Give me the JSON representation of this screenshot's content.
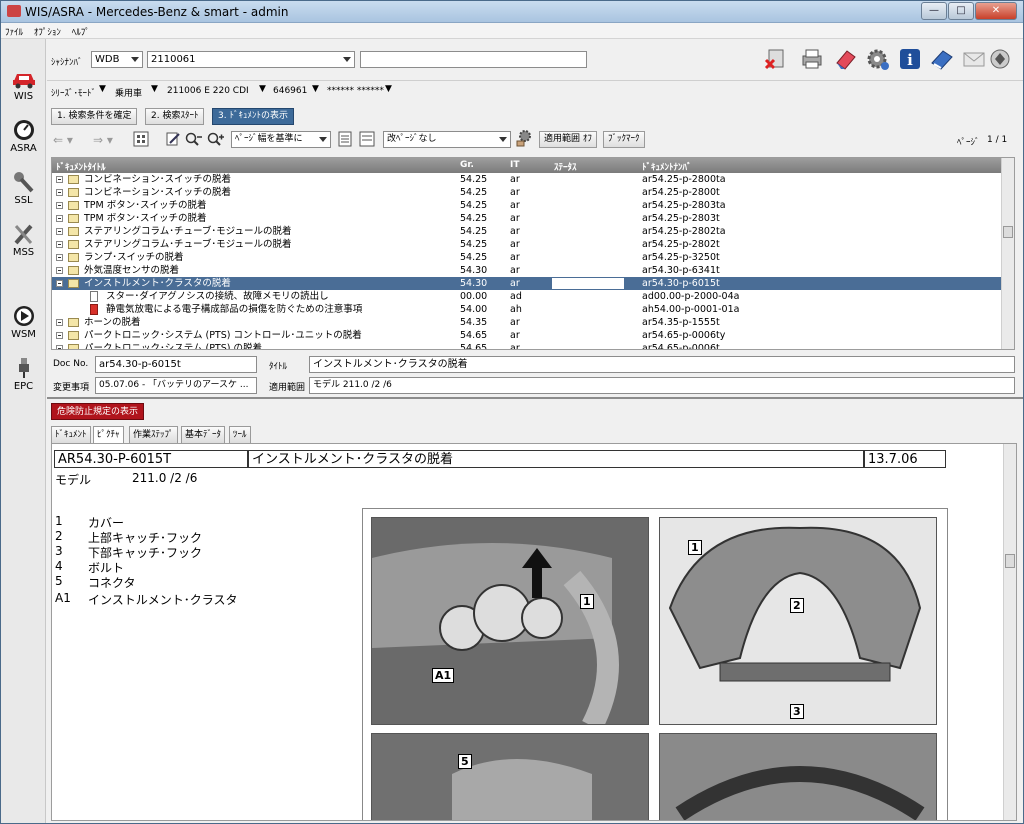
{
  "window": {
    "title": "WIS/ASRA - Mercedes-Benz & smart - admin",
    "btn_min": "—",
    "btn_max": "□",
    "btn_close": "✕"
  },
  "menu": [
    "ﾌｧｲﾙ",
    "ｵﾌﾟｼｮﾝ",
    "ﾍﾙﾌﾟ"
  ],
  "sidebar": {
    "items": [
      {
        "label": "WIS",
        "icon": "car-icon"
      },
      {
        "label": "ASRA",
        "icon": "clock-gauge-icon"
      },
      {
        "label": "SSL",
        "icon": "wrench-icon"
      },
      {
        "label": "MSS",
        "icon": "tools-icon"
      },
      {
        "label": "WSM",
        "icon": "play-circle-icon"
      },
      {
        "label": "EPC",
        "icon": "spark-plug-icon"
      }
    ]
  },
  "vin": {
    "label": "ｼｬｼﾅﾝﾊﾞ",
    "prefix": "WDB",
    "number": "2110061"
  },
  "series": {
    "label": "ｼﾘｰｽﾞ･ﾓｰﾄﾞ",
    "type": "乗用車",
    "model": "211006 E 220 CDI",
    "engine": "646961",
    "extra": "****** ******"
  },
  "steps": [
    {
      "label": "1. 検索条件を確定",
      "active": false
    },
    {
      "label": "2. 検索ｽﾀｰﾄ",
      "active": false
    },
    {
      "label": "3. ﾄﾞｷｭﾒﾝﾄの表示",
      "active": true
    }
  ],
  "toolbar2": {
    "filter": "ﾍﾟｰｼﾞ幅を基準に",
    "pagebreak": "改ﾍﾟｰｼﾞなし",
    "scope_btn": "適用範囲 ｵﾌ",
    "bookmark_btn": "ﾌﾞｯｸﾏｰｸ",
    "page_label": "ﾍﾟｰｼﾞ",
    "page": "1 / 1"
  },
  "table": {
    "headers": {
      "title": "ﾄﾞｷｭﾒﾝﾄﾀｲﾄﾙ",
      "gr": "Gr.",
      "it": "IT",
      "status": "ｽﾃｰﾀｽ",
      "docno": "ﾄﾞｷｭﾒﾝﾄﾅﾝﾊﾞ"
    },
    "rows": [
      {
        "title": "コンビネーション･スイッチの脱着",
        "gr": "54.25",
        "it": "ar",
        "doc": "ar54.25-p-2800ta",
        "kind": "folder",
        "level": 0
      },
      {
        "title": "コンビネーション･スイッチの脱着",
        "gr": "54.25",
        "it": "ar",
        "doc": "ar54.25-p-2800t",
        "kind": "folder",
        "level": 0
      },
      {
        "title": "TPM ボタン･スイッチの脱着",
        "gr": "54.25",
        "it": "ar",
        "doc": "ar54.25-p-2803ta",
        "kind": "folder",
        "level": 0
      },
      {
        "title": "TPM ボタン･スイッチの脱着",
        "gr": "54.25",
        "it": "ar",
        "doc": "ar54.25-p-2803t",
        "kind": "folder",
        "level": 0
      },
      {
        "title": "ステアリングコラム･チューブ･モジュールの脱着",
        "gr": "54.25",
        "it": "ar",
        "doc": "ar54.25-p-2802ta",
        "kind": "folder",
        "level": 0
      },
      {
        "title": "ステアリングコラム･チューブ･モジュールの脱着",
        "gr": "54.25",
        "it": "ar",
        "doc": "ar54.25-p-2802t",
        "kind": "folder",
        "level": 0
      },
      {
        "title": "ランプ･スイッチの脱着",
        "gr": "54.25",
        "it": "ar",
        "doc": "ar54.25-p-3250t",
        "kind": "folder",
        "level": 0
      },
      {
        "title": "外気温度センサの脱着",
        "gr": "54.30",
        "it": "ar",
        "doc": "ar54.30-p-6341t",
        "kind": "folder",
        "level": 0
      },
      {
        "title": "インストルメント･クラスタの脱着",
        "gr": "54.30",
        "it": "ar",
        "doc": "ar54.30-p-6015t",
        "kind": "folder",
        "level": 0,
        "selected": true
      },
      {
        "title": "スター･ダイアグノシスの接続、故障メモリの読出し",
        "gr": "00.00",
        "it": "ad",
        "doc": "ad00.00-p-2000-04a",
        "kind": "doc",
        "level": 1
      },
      {
        "title": "静電気放電による電子構成部品の損傷を防ぐための注意事項",
        "gr": "54.00",
        "it": "ah",
        "doc": "ah54.00-p-0001-01a",
        "kind": "docred",
        "level": 1
      },
      {
        "title": "ホーンの脱着",
        "gr": "54.35",
        "it": "ar",
        "doc": "ar54.35-p-1555t",
        "kind": "folder",
        "level": 0
      },
      {
        "title": "パークトロニック･システム (PTS) コントロール･ユニットの脱着",
        "gr": "54.65",
        "it": "ar",
        "doc": "ar54.65-p-0006ty",
        "kind": "folder",
        "level": 0
      },
      {
        "title": "パークトロニック･システム (PTS) の脱着",
        "gr": "54.65",
        "it": "ar",
        "doc": "ar54.65-p-0006t",
        "kind": "folder",
        "level": 0
      }
    ]
  },
  "docinfo": {
    "docno_label": "Doc No.",
    "docno": "ar54.30-p-6015t",
    "title_label": "ﾀｲﾄﾙ",
    "title": "インストルメント･クラスタの脱着",
    "change_label": "変更事項",
    "change": "05.07.06 - 「バッテリのアースケ ...",
    "scope_label": "適用範囲",
    "scope": "モデル 211.0 /2 /6"
  },
  "danger_btn": "危険防止規定の表示",
  "tabs": [
    {
      "label": "ﾄﾞｷｭﾒﾝﾄ",
      "active": false
    },
    {
      "label": "ﾋﾟｸﾁｬ",
      "active": true
    },
    {
      "label": "作業ｽﾃｯﾌﾟ",
      "active": false
    },
    {
      "label": "基本ﾃﾞｰﾀ",
      "active": false
    },
    {
      "label": "ﾂｰﾙ",
      "active": false
    }
  ],
  "doc": {
    "code": "AR54.30-P-6015T",
    "title": "インストルメント･クラスタの脱着",
    "date": "13.7.06",
    "model_label": "モデル",
    "model": "211.0 /2 /6",
    "legend": [
      {
        "no": "1",
        "text": "カバー"
      },
      {
        "no": "2",
        "text": "上部キャッチ･フック"
      },
      {
        "no": "3",
        "text": "下部キャッチ･フック"
      },
      {
        "no": "4",
        "text": "ボルト"
      },
      {
        "no": "5",
        "text": "コネクタ"
      }
    ],
    "legend_a1": {
      "no": "A1",
      "text": "インストルメント･クラスタ"
    },
    "callouts": [
      "1",
      "A1",
      "1",
      "2",
      "3",
      "5"
    ]
  }
}
